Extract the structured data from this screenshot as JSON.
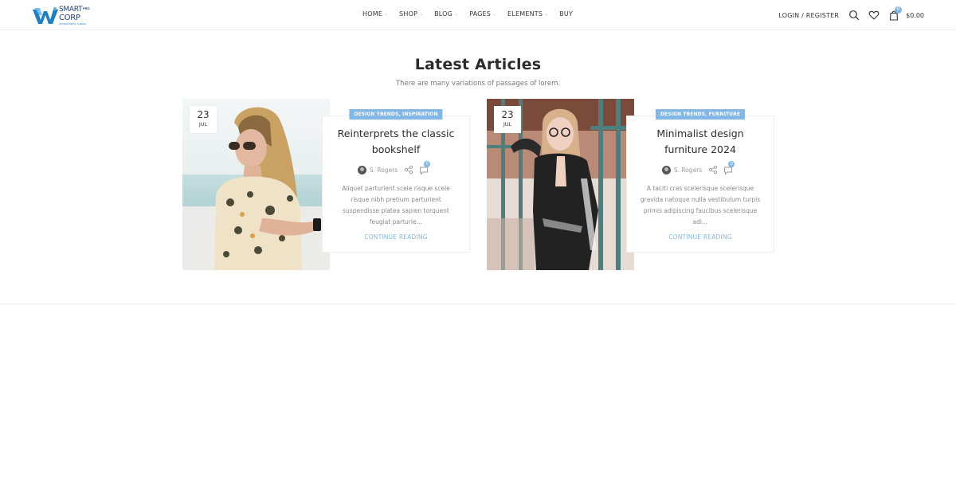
{
  "colors": {
    "accent": "#83b7e6",
    "brand": "#1c7fc4",
    "text": "#333333"
  },
  "header": {
    "logo": {
      "line1": "SMART",
      "line2": "CORP",
      "badge": "PRO",
      "tagline": "WORDPRESS THEME"
    },
    "nav": [
      {
        "label": "HOME",
        "has_dropdown": true
      },
      {
        "label": "SHOP",
        "has_dropdown": true
      },
      {
        "label": "BLOG",
        "has_dropdown": true
      },
      {
        "label": "PAGES",
        "has_dropdown": true
      },
      {
        "label": "ELEMENTS",
        "has_dropdown": true
      },
      {
        "label": "BUY",
        "has_dropdown": false
      }
    ],
    "login_label": "LOGIN / REGISTER",
    "icons": [
      "search-icon",
      "heart-icon",
      "cart-icon"
    ],
    "cart": {
      "count": "0",
      "total": "$0.00"
    }
  },
  "section": {
    "title": "Latest Articles",
    "subtitle": "There are many variations of passages of lorem."
  },
  "articles": [
    {
      "day": "23",
      "month": "JUL",
      "categories": "DESIGN TRENDS, INSPIRATION",
      "title": "Reinterprets the classic bookshelf",
      "author": "S. Rogers",
      "comments": "0",
      "excerpt": "Aliquet parturient scele risque scele risque nibh pretium parturient suspendisse platea sapien torquent feugiat parturie…",
      "read_more": "CONTINUE READING"
    },
    {
      "day": "23",
      "month": "JUL",
      "categories": "DESIGN TRENDS, FURNITURE",
      "title": "Minimalist design furniture 2024",
      "author": "S. Rogers",
      "comments": "0",
      "excerpt": "A taciti cras scelerisque scelerisque gravida natoque nulla vestibulum turpis primis adipiscing faucibus scelerisque adi…",
      "read_more": "CONTINUE READING"
    }
  ]
}
